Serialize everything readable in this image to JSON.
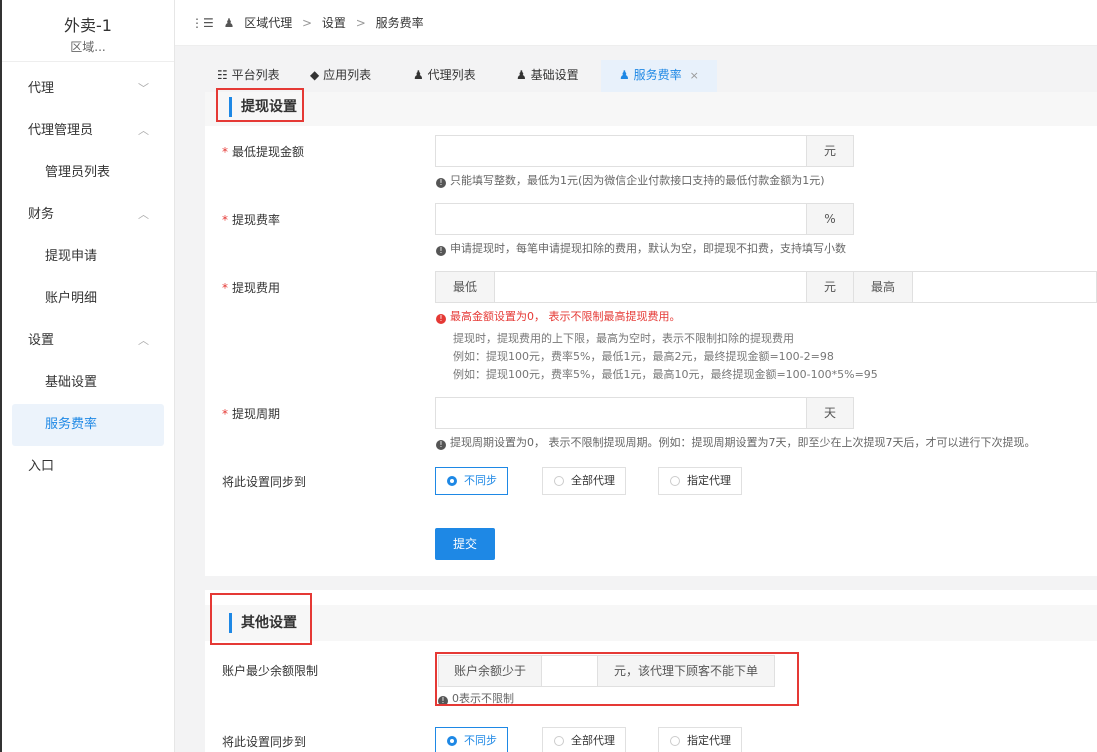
{
  "app": {
    "title": "外卖-1",
    "subtitle": "区域..."
  },
  "sidebar": {
    "items": [
      {
        "label": "代理",
        "chevron": "﹀"
      },
      {
        "label": "代理管理员",
        "chevron": "︿"
      },
      {
        "label": "管理员列表"
      },
      {
        "label": "财务",
        "chevron": "︿"
      },
      {
        "label": "提现申请"
      },
      {
        "label": "账户明细"
      },
      {
        "label": "设置",
        "chevron": "︿"
      },
      {
        "label": "基础设置"
      },
      {
        "label": "服务费率"
      },
      {
        "label": "入口"
      }
    ]
  },
  "breadcrumb": {
    "toggle": "⋮☰",
    "items": [
      "区域代理",
      "设置",
      "服务费率"
    ],
    "sep": ">"
  },
  "tabs": [
    {
      "icon": "☷",
      "label": "平台列表"
    },
    {
      "icon": "◆",
      "label": "应用列表"
    },
    {
      "icon": "♟",
      "label": "代理列表"
    },
    {
      "icon": "♟",
      "label": "基础设置"
    },
    {
      "icon": "♟",
      "label": "服务费率",
      "close": "×"
    }
  ],
  "withdraw": {
    "title": "提现设置",
    "min_amount": {
      "label": "最低提现金额",
      "value": "",
      "unit": "元",
      "hint": "只能填写整数，最低为1元(因为微信企业付款接口支持的最低付款金额为1元)"
    },
    "rate": {
      "label": "提现费率",
      "value": "",
      "unit": "%",
      "hint": "申请提现时，每笔申请提现扣除的费用，默认为空，即提现不扣费，支持填写小数"
    },
    "fee": {
      "label": "提现费用",
      "low_label": "最低",
      "low_value": "",
      "unit": "元",
      "high_label": "最高",
      "high_value": "",
      "error": "最高金额设置为0， 表示不限制最高提现费用。",
      "desc1": "提现时，提现费用的上下限，最高为空时，表示不限制扣除的提现费用",
      "desc2": "例如：提现100元，费率5%，最低1元，最高2元，最终提现金额=100-2=98",
      "desc3": "例如：提现100元，费率5%，最低1元，最高10元，最终提现金额=100-100*5%=95"
    },
    "period": {
      "label": "提现周期",
      "value": "",
      "unit": "天",
      "hint": "提现周期设置为0， 表示不限制提现周期。例如：提现周期设置为7天，即至少在上次提现7天后，才可以进行下次提现。"
    },
    "sync": {
      "label": "将此设置同步到",
      "options": [
        "不同步",
        "全部代理",
        "指定代理"
      ],
      "selected": "不同步"
    },
    "submit": "提交"
  },
  "other": {
    "title": "其他设置",
    "min_balance": {
      "label": "账户最少余额限制",
      "prefix": "账户余额少于",
      "value": "",
      "suffix": "元，该代理下顾客不能下单",
      "hint": "0表示不限制"
    },
    "sync": {
      "label": "将此设置同步到",
      "options": [
        "不同步",
        "全部代理",
        "指定代理"
      ],
      "selected": "不同步"
    }
  },
  "colors": {
    "accent": "#1e88e5",
    "danger": "#e53935"
  }
}
